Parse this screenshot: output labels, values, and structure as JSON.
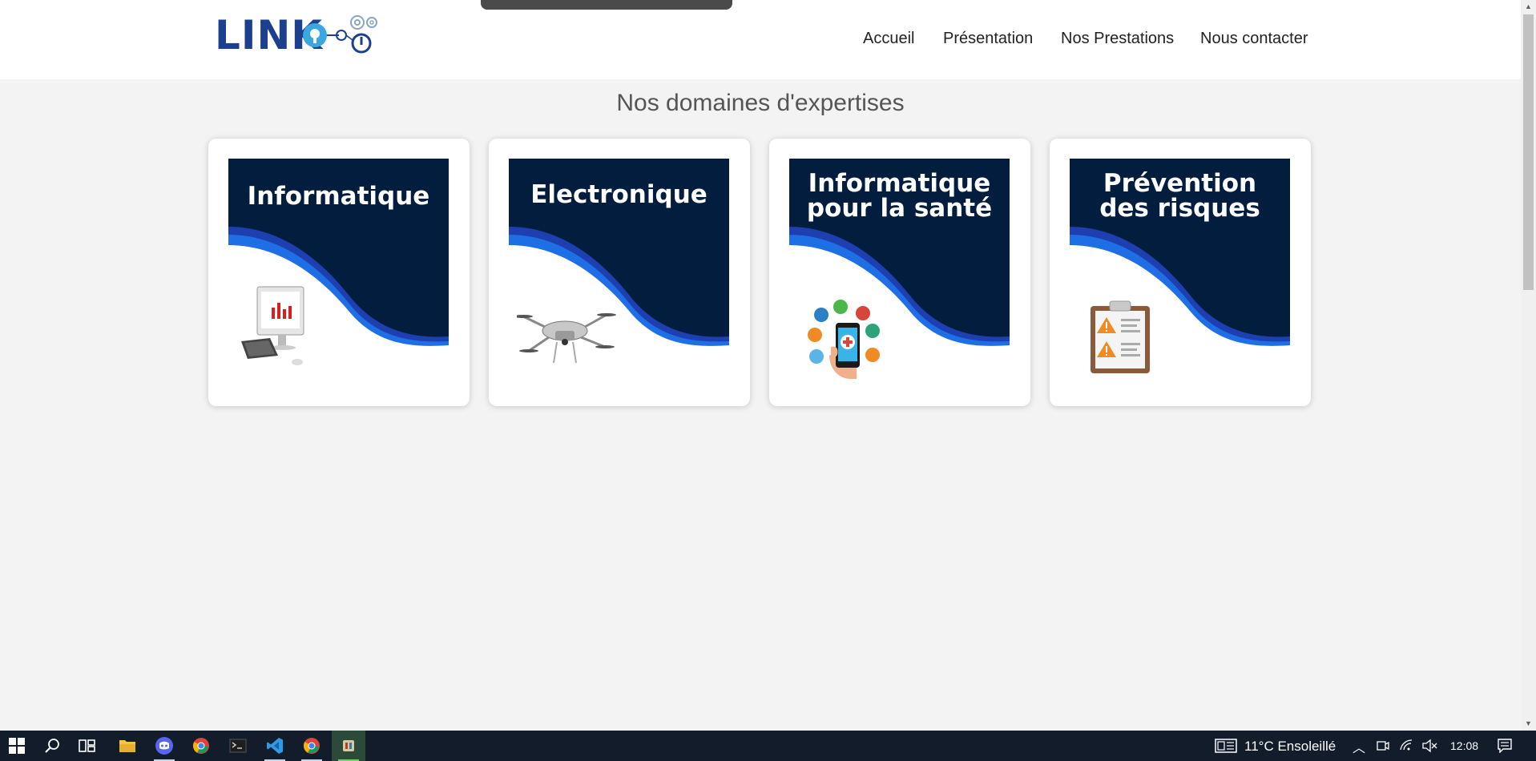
{
  "header": {
    "logo_text": "LINK",
    "nav": [
      "Accueil",
      "Présentation",
      "Nos Prestations",
      "Nous contacter"
    ]
  },
  "main": {
    "section_title": "Nos domaines d'expertises",
    "cards": [
      {
        "lines": [
          "Informatique"
        ],
        "illustration": "computer-icon"
      },
      {
        "lines": [
          "Electronique"
        ],
        "illustration": "drone-icon"
      },
      {
        "lines": [
          "Informatique",
          "pour la santé"
        ],
        "illustration": "health-phone-icon"
      },
      {
        "lines": [
          "Prévention",
          "des risques"
        ],
        "illustration": "clipboard-warning-icon"
      }
    ]
  },
  "taskbar": {
    "apps": [
      "windows-start-icon",
      "search-icon",
      "task-view-icon",
      "file-explorer-icon",
      "discord-icon",
      "chrome-icon",
      "terminal-icon",
      "vscode-icon",
      "chrome-icon",
      "app-icon"
    ],
    "weather": "11°C  Ensoleillé",
    "clock": "12:08"
  },
  "colors": {
    "card_navy": "#021d3e",
    "wave_blue": "#1e6fe6",
    "wave_dark": "#1d3fb0",
    "logo_blue": "#1c3f8f",
    "logo_light": "#3aa8e0",
    "page_bg": "#f3f3f3",
    "taskbar_bg": "#121c2a"
  }
}
